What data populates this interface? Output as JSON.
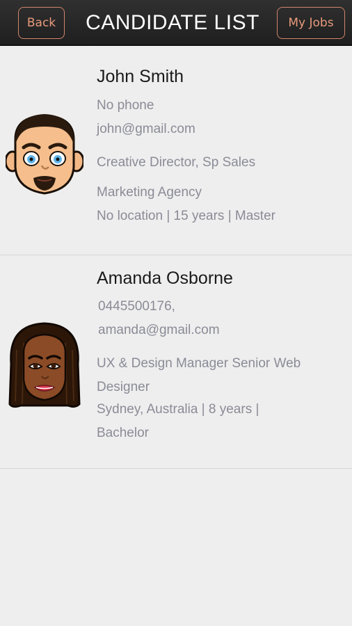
{
  "header": {
    "back_label": "Back",
    "title": "CANDIDATE LIST",
    "jobs_label": "My Jobs"
  },
  "candidates": [
    {
      "name": "John Smith",
      "phone": "No phone",
      "email": "john@gmail.com",
      "title": "Creative Director, Sp  Sales",
      "company": "Marketing Agency",
      "details": "No location | 15 years | Master",
      "avatar_icon": "male-avatar-icon"
    },
    {
      "name": "Amanda  Osborne",
      "phone": "0445500176,",
      "email": "amanda@gmail.com",
      "title_line1": "UX & Design Manager Senior Web",
      "title_line2": "Designer",
      "details_line1": "Sydney, Australia | 8 years |",
      "details_line2": "Bachelor",
      "avatar_icon": "female-avatar-icon"
    }
  ],
  "colors": {
    "header_bg": "#262626",
    "button_accent": "#e89a7c",
    "background": "#eeeeee",
    "secondary_text": "#8b8b97"
  }
}
